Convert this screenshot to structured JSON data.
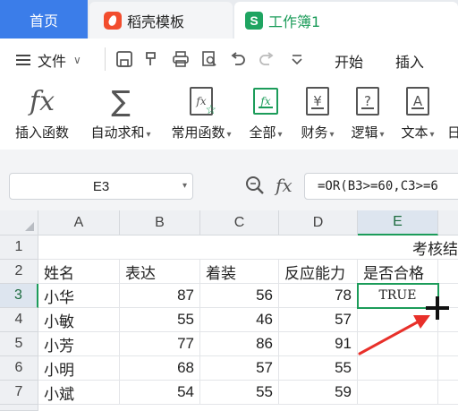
{
  "tabs": {
    "home": "首页",
    "templates": "稻壳模板",
    "workbook": "工作簿1"
  },
  "menu": {
    "file": "文件",
    "start": "开始",
    "insert": "插入"
  },
  "ribbon": {
    "insert_function": "插入函数",
    "autosum": "自动求和",
    "common_functions": "常用函数",
    "all": "全部",
    "finance": "财务",
    "logic": "逻辑",
    "text": "文本",
    "date_partial": "日"
  },
  "formula_bar": {
    "name_box": "E3",
    "fx": "fx",
    "formula": "=OR(B3>=60,C3>=6"
  },
  "grid": {
    "columns": [
      "A",
      "B",
      "C",
      "D",
      "E"
    ],
    "rows": [
      "1",
      "2",
      "3",
      "4",
      "5",
      "6",
      "7"
    ],
    "title_partial": "考核结",
    "headers": [
      "姓名",
      "表达",
      "着装",
      "反应能力",
      "是否合格"
    ],
    "data": [
      {
        "name": "小华",
        "b": "87",
        "c": "56",
        "d": "78",
        "e": "TRUE"
      },
      {
        "name": "小敏",
        "b": "55",
        "c": "46",
        "d": "57",
        "e": ""
      },
      {
        "name": "小芳",
        "b": "77",
        "c": "86",
        "d": "91",
        "e": ""
      },
      {
        "name": "小明",
        "b": "68",
        "c": "57",
        "d": "55",
        "e": ""
      },
      {
        "name": "小斌",
        "b": "54",
        "c": "55",
        "d": "59",
        "e": ""
      }
    ]
  },
  "colors": {
    "accent": "#3b7de9",
    "sheet_green": "#1c9c5a",
    "annotation_red": "#e8302a"
  }
}
